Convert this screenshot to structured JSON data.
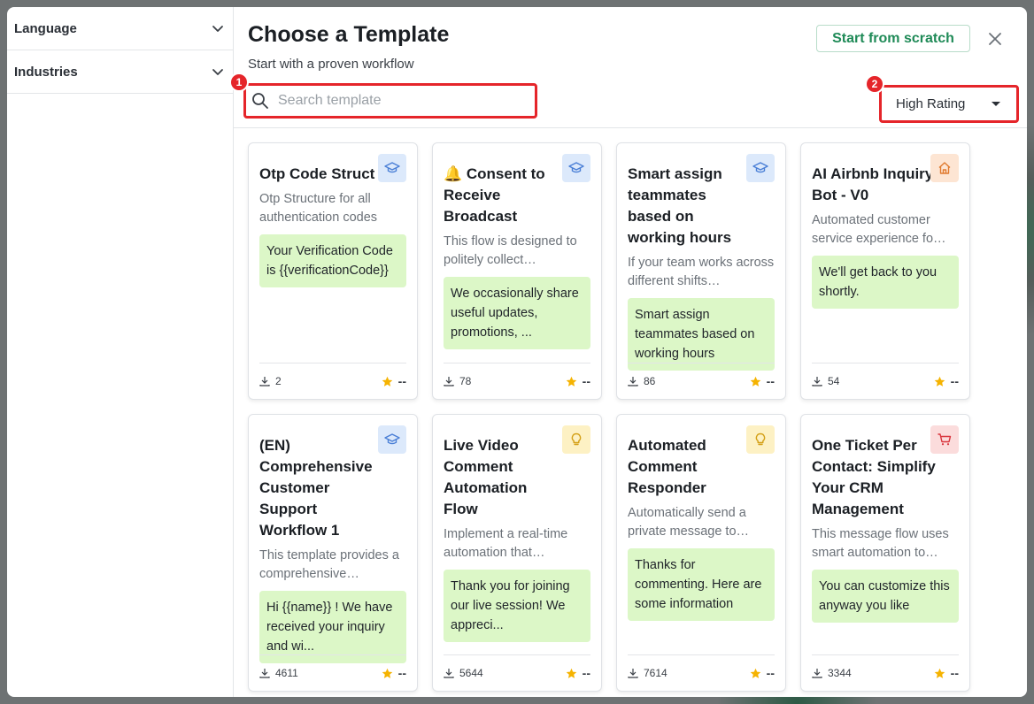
{
  "sidebar": {
    "filters": [
      {
        "label": "Language"
      },
      {
        "label": "Industries"
      }
    ]
  },
  "header": {
    "title": "Choose a Template",
    "subtitle": "Start with a proven workflow",
    "scratch_label": "Start from scratch"
  },
  "search": {
    "placeholder": "Search template",
    "badge": "1"
  },
  "sort": {
    "selected": "High Rating",
    "badge": "2"
  },
  "colors": {
    "accent_green": "#1f8a57",
    "bubble_green": "#dcf7c7",
    "annotation_red": "#e5252a",
    "star": "#f5b301"
  },
  "cards": [
    {
      "title": "Otp Code Struct",
      "icon": "graduation-cap-icon",
      "description": "Otp Structure for all authentication codes",
      "bubble": "Your Verification Code is {{verificationCode}}",
      "downloads": "2",
      "rating": "--"
    },
    {
      "title": "🔔 Consent to Receive Broadcast",
      "icon": "graduation-cap-icon",
      "description": "This flow is designed to politely collect…",
      "bubble": "We occasionally share useful updates, promotions, ...",
      "downloads": "78",
      "rating": "--"
    },
    {
      "title": "Smart assign teammates based on working hours",
      "icon": "graduation-cap-icon",
      "description": "If your team works across different shifts…",
      "bubble": "Smart assign teammates based on working hours",
      "downloads": "86",
      "rating": "--"
    },
    {
      "title": "AI Airbnb Inquiry Bot - V0",
      "icon": "house-icon",
      "description": "Automated customer service experience fo…",
      "bubble": "We'll get back to you shortly.",
      "downloads": "54",
      "rating": "--"
    },
    {
      "title": "(EN) Comprehensive Customer Support Workflow 1",
      "icon": "graduation-cap-icon",
      "description": "This template provides a comprehensive…",
      "bubble": "Hi {{name}} ! We have received your inquiry and wi...",
      "downloads": "4611",
      "rating": "--"
    },
    {
      "title": "Live Video Comment Automation Flow",
      "icon": "lightbulb-icon",
      "description": "Implement a real-time automation that…",
      "bubble": "Thank you for joining our live session! We appreci...",
      "downloads": "5644",
      "rating": "--"
    },
    {
      "title": "Automated Comment Responder",
      "icon": "lightbulb-icon",
      "description": "Automatically send a private message to…",
      "bubble": "Thanks for commenting. Here are some information",
      "downloads": "7614",
      "rating": "--"
    },
    {
      "title": "One Ticket Per Contact: Simplify Your CRM Management",
      "icon": "shopping-cart-icon",
      "description": "This message flow uses smart automation to…",
      "bubble": "You can customize this anyway you like",
      "downloads": "3344",
      "rating": "--"
    }
  ]
}
